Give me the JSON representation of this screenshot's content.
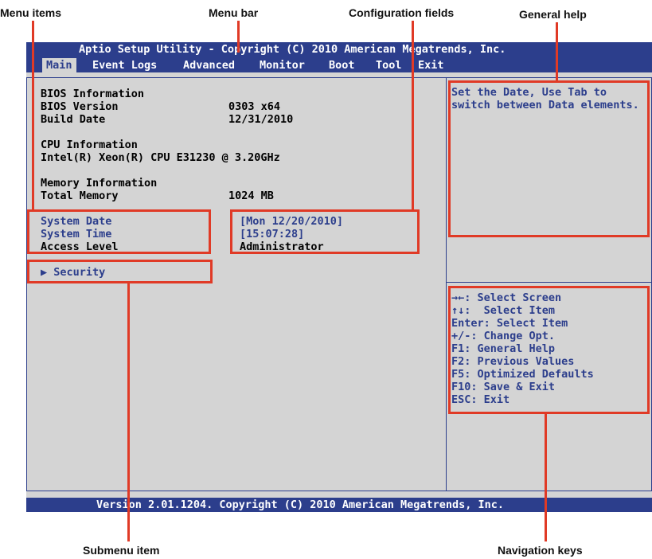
{
  "callouts": {
    "menu_items": "Menu items",
    "menu_bar": "Menu bar",
    "configuration_fields": "Configuration fields",
    "general_help": "General help",
    "submenu_item": "Submenu item",
    "navigation_keys": "Navigation keys"
  },
  "title_bar": "Aptio Setup Utility - Copyright (C) 2010 American Megatrends, Inc.",
  "menu": [
    "Main",
    "Event Logs",
    "Advanced",
    "Monitor",
    "Boot",
    "Tool",
    "Exit"
  ],
  "active_menu": "Main",
  "main": {
    "bios_info": {
      "heading": "BIOS Information",
      "version_label": "BIOS Version",
      "version_value": "0303 x64",
      "date_label": "Build Date",
      "date_value": "12/31/2010"
    },
    "cpu_info": {
      "heading": "CPU Information",
      "model": "Intel(R) Xeon(R) CPU E31230 @ 3.20GHz"
    },
    "memory_info": {
      "heading": "Memory Information",
      "total_label": "Total Memory",
      "total_value": "1024 MB"
    },
    "system_date": {
      "label": "System Date",
      "value": "[Mon 12/20/2010]"
    },
    "system_time": {
      "label": "System Time",
      "value": "[15:07:28]"
    },
    "access_level": {
      "label": "Access Level",
      "value": "Administrator"
    },
    "submenu": {
      "arrow": "▶",
      "label": "Security"
    }
  },
  "help": [
    "Set the Date, Use Tab to",
    "switch between Data elements."
  ],
  "nav_keys": [
    "→←: Select Screen",
    "↑↓:  Select Item",
    "Enter: Select Item",
    "+/-: Change Opt.",
    "F1: General Help",
    "F2: Previous Values",
    "F5: Optimized Defaults",
    "F10: Save & Exit",
    "ESC: Exit"
  ],
  "footer": "Version 2.01.1204. Copyright (C) 2010 American Megatrends, Inc.",
  "colors": {
    "bios_blue": "#2c3e8c",
    "panel_gray": "#d4d4d4",
    "callout_red": "#e03a26"
  }
}
